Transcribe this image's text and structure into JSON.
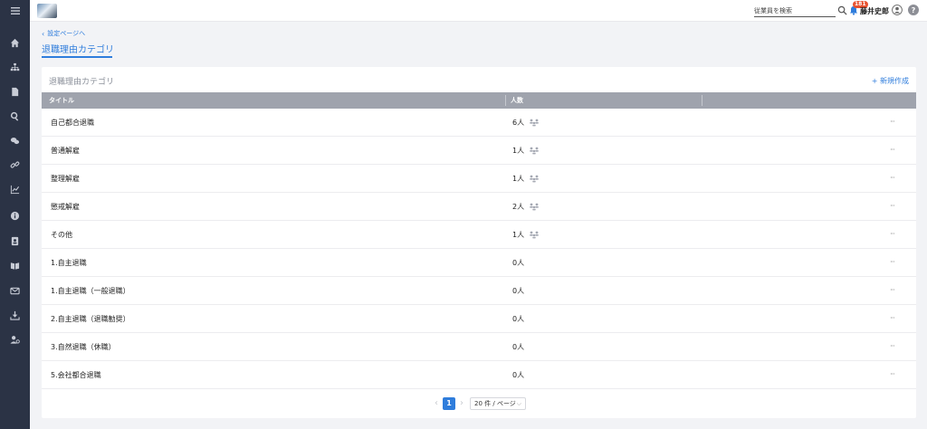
{
  "topbar": {
    "search_placeholder": "従業員を検索",
    "notification_count": "181",
    "user_name": "藤井史郎",
    "help_label": "?"
  },
  "header": {
    "back_link": "設定ページへ",
    "title": "退職理由カテゴリ"
  },
  "card": {
    "title": "退職理由カテゴリ",
    "new_button": "+ 新規作成",
    "columns": [
      "タイトル",
      "人数"
    ],
    "rows": [
      {
        "title": "自己都合退職",
        "count": "6人",
        "has_people_icon": true
      },
      {
        "title": "普通解雇",
        "count": "1人",
        "has_people_icon": true
      },
      {
        "title": "整理解雇",
        "count": "1人",
        "has_people_icon": true
      },
      {
        "title": "懲戒解雇",
        "count": "2人",
        "has_people_icon": true
      },
      {
        "title": "その他",
        "count": "1人",
        "has_people_icon": true
      },
      {
        "title": "1.自主退職",
        "count": "0人",
        "has_people_icon": false
      },
      {
        "title": "1.自主退職（一般退職）",
        "count": "0人",
        "has_people_icon": false
      },
      {
        "title": "2.自主退職（退職勧奨）",
        "count": "0人",
        "has_people_icon": false
      },
      {
        "title": "3.自然退職（休職）",
        "count": "0人",
        "has_people_icon": false
      },
      {
        "title": "5.会社都合退職",
        "count": "0人",
        "has_people_icon": false
      }
    ]
  },
  "pagination": {
    "current_page": "1",
    "page_size": "20 件 / ページ"
  },
  "colors": {
    "accent": "#2f7ddc",
    "sidebar": "#2b3345",
    "table_header": "#9fa3ad",
    "badge": "#e8522f"
  },
  "sidebar_icons": [
    "menu-icon",
    "home-icon",
    "org-chart-icon",
    "document-icon",
    "search-icon",
    "chat-icon",
    "link-icon",
    "chart-icon",
    "info-icon",
    "contact-icon",
    "book-icon",
    "mail-icon",
    "download-icon",
    "user-settings-icon"
  ]
}
